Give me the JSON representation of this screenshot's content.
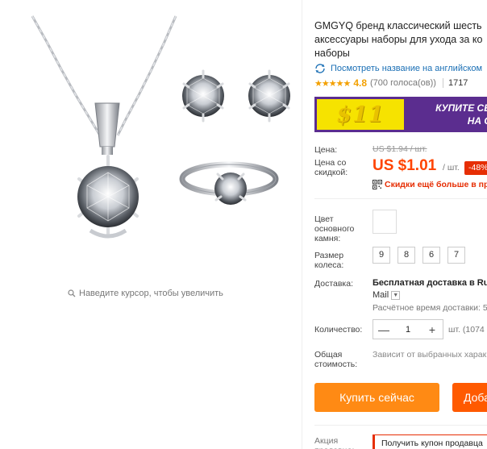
{
  "gallery": {
    "zoom_hint": "Наведите курсор, чтобы увеличить"
  },
  "product": {
    "title": "GMGYQ бренд классический шесть\nаксессуары наборы для ухода за ко\nнаборы",
    "translate_link": "Посмотреть название на английском",
    "rating": "4.8",
    "votes": "(700 голоса(ов))",
    "orders": "1717",
    "banner_price": "$11",
    "banner_text": "КУПИТЕ СЕЙЧА\nНА СЛЕД"
  },
  "pricing": {
    "price_label": "Цена:",
    "old_price": "US $1.94 / шт.",
    "discount_label": "Цена со\nскидкой:",
    "new_price": "US $1.01",
    "per_unit": "/ шт.",
    "discount": "-48%",
    "coupon_text": "Скидки ещё больше в при"
  },
  "options": {
    "color_label": "Цвет\nосновного\nкамня:",
    "size_label": "Размер\nколеса:",
    "sizes": [
      "9",
      "8",
      "6",
      "7"
    ]
  },
  "shipping": {
    "label": "Доставка:",
    "value": "Бесплатная доставка в Rus",
    "carrier": "Mail",
    "eta": "Расчётное время доставки: 5"
  },
  "quantity": {
    "label": "Количество:",
    "value": "1",
    "minus": "—",
    "plus": "+",
    "available": "шт. (1074"
  },
  "total": {
    "label": "Общая\nстоимость:",
    "value": "Зависит от выбранных харак"
  },
  "actions": {
    "buy_now": "Купить сейчас",
    "add_to_cart": "Доба"
  },
  "promo": {
    "label": "Акция\nпродавца:",
    "coupon": "Получить купон продавца"
  },
  "colors": {
    "accent_orange": "#ff8a14",
    "price_red": "#ff4400",
    "link_blue": "#1a6fb5",
    "banner_purple": "#5b2d8f",
    "banner_yellow": "#f6e300"
  }
}
